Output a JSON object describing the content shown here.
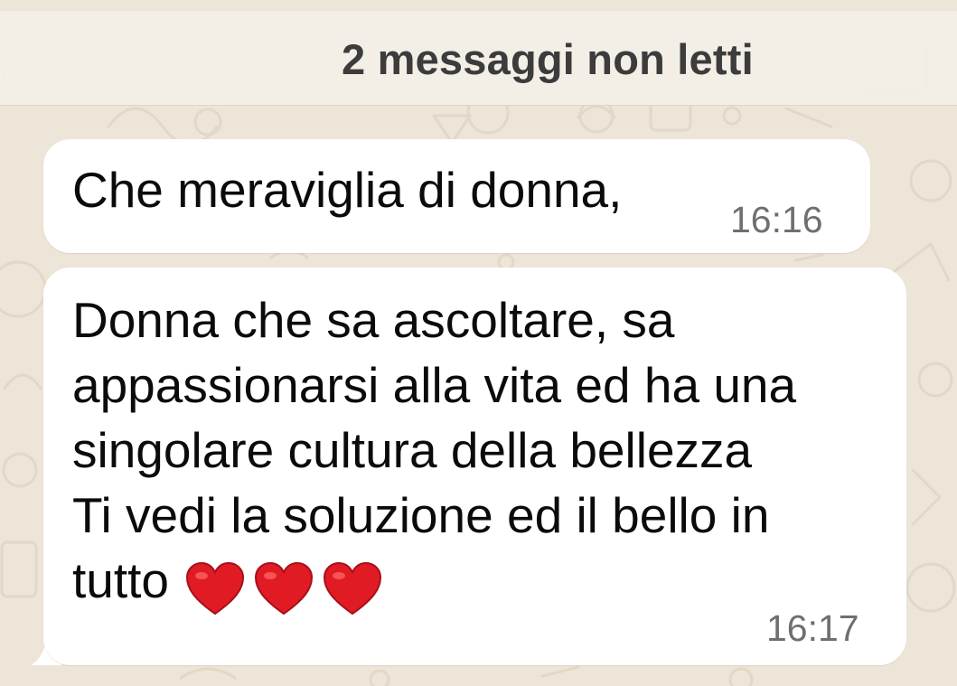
{
  "unread_banner": {
    "label": "2 messaggi non letti"
  },
  "messages": [
    {
      "lines": [
        "Che meraviglia di donna,"
      ],
      "time": "16:16"
    },
    {
      "lines": [
        "Donna che sa ascoltare, sa",
        "appassionarsi alla vita ed ha una",
        "singolare cultura della bellezza",
        "Ti vedi la soluzione ed il bello in",
        "tutto"
      ],
      "emoji": [
        "red-heart",
        "red-heart",
        "red-heart"
      ],
      "time": "16:17"
    }
  ],
  "colors": {
    "wallpaper": "#ede5d8",
    "bubble": "#ffffff",
    "text": "#0b0b0b",
    "timestamp": "#6f6f6f",
    "heart": "#e01b24"
  }
}
